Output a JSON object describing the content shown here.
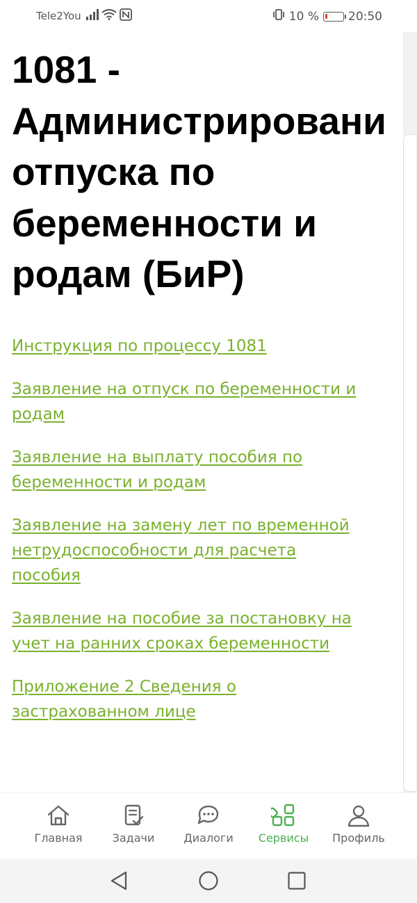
{
  "status_bar": {
    "carrier": "Tele2You",
    "battery_text": "10 %",
    "time": "20:50",
    "battery_color": "#e53935"
  },
  "page": {
    "title": "1081 -\nАдминистрировани\nотпуска по\nбеременности и\nродам (БиР)"
  },
  "links": [
    {
      "label": "Инструкция по процессу 1081"
    },
    {
      "label": "Заявление на отпуск по беременности и\nродам"
    },
    {
      "label": "Заявление на выплату пособия по\nбеременности и родам"
    },
    {
      "label": "Заявление на замену лет по временной\nнетрудоспособности для расчета\nпособия"
    },
    {
      "label": "Заявление на пособие за постановку на\nучет на ранних сроках беременности"
    },
    {
      "label": "Приложение 2 Сведения о\nзастрахованном лице"
    }
  ],
  "bottom_nav": {
    "items": [
      {
        "label": "Главная",
        "icon": "home-icon"
      },
      {
        "label": "Задачи",
        "icon": "tasks-icon"
      },
      {
        "label": "Диалоги",
        "icon": "chat-icon"
      },
      {
        "label": "Сервисы",
        "icon": "services-icon",
        "active": true
      },
      {
        "label": "Профиль",
        "icon": "profile-icon"
      }
    ]
  },
  "colors": {
    "link": "#79b12c",
    "active_nav": "#4caf50",
    "inactive_nav": "#666666"
  }
}
